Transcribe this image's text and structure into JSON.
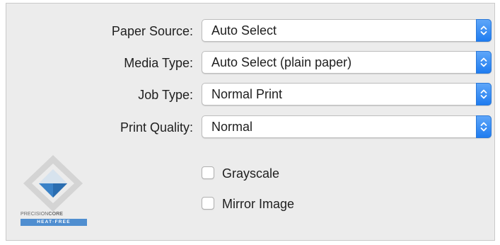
{
  "settings": [
    {
      "label": "Paper Source:",
      "value": "Auto Select"
    },
    {
      "label": "Media Type:",
      "value": "Auto Select (plain paper)"
    },
    {
      "label": "Job Type:",
      "value": "Normal Print"
    },
    {
      "label": "Print Quality:",
      "value": "Normal"
    }
  ],
  "options": [
    {
      "label": "Grayscale",
      "checked": false
    },
    {
      "label": "Mirror Image",
      "checked": false
    }
  ],
  "logo": {
    "wordmark_light": "PRECISION",
    "wordmark_bold": "CORE",
    "bar_text": "HEAT·FREE"
  },
  "colors": {
    "accent": "#2f86f5",
    "panel_background": "#ececec",
    "logo_blue": "#4f8ed0"
  },
  "icons": {
    "stepper": "up-down-arrows-icon",
    "logo": "precisioncore-diamond-logo"
  }
}
